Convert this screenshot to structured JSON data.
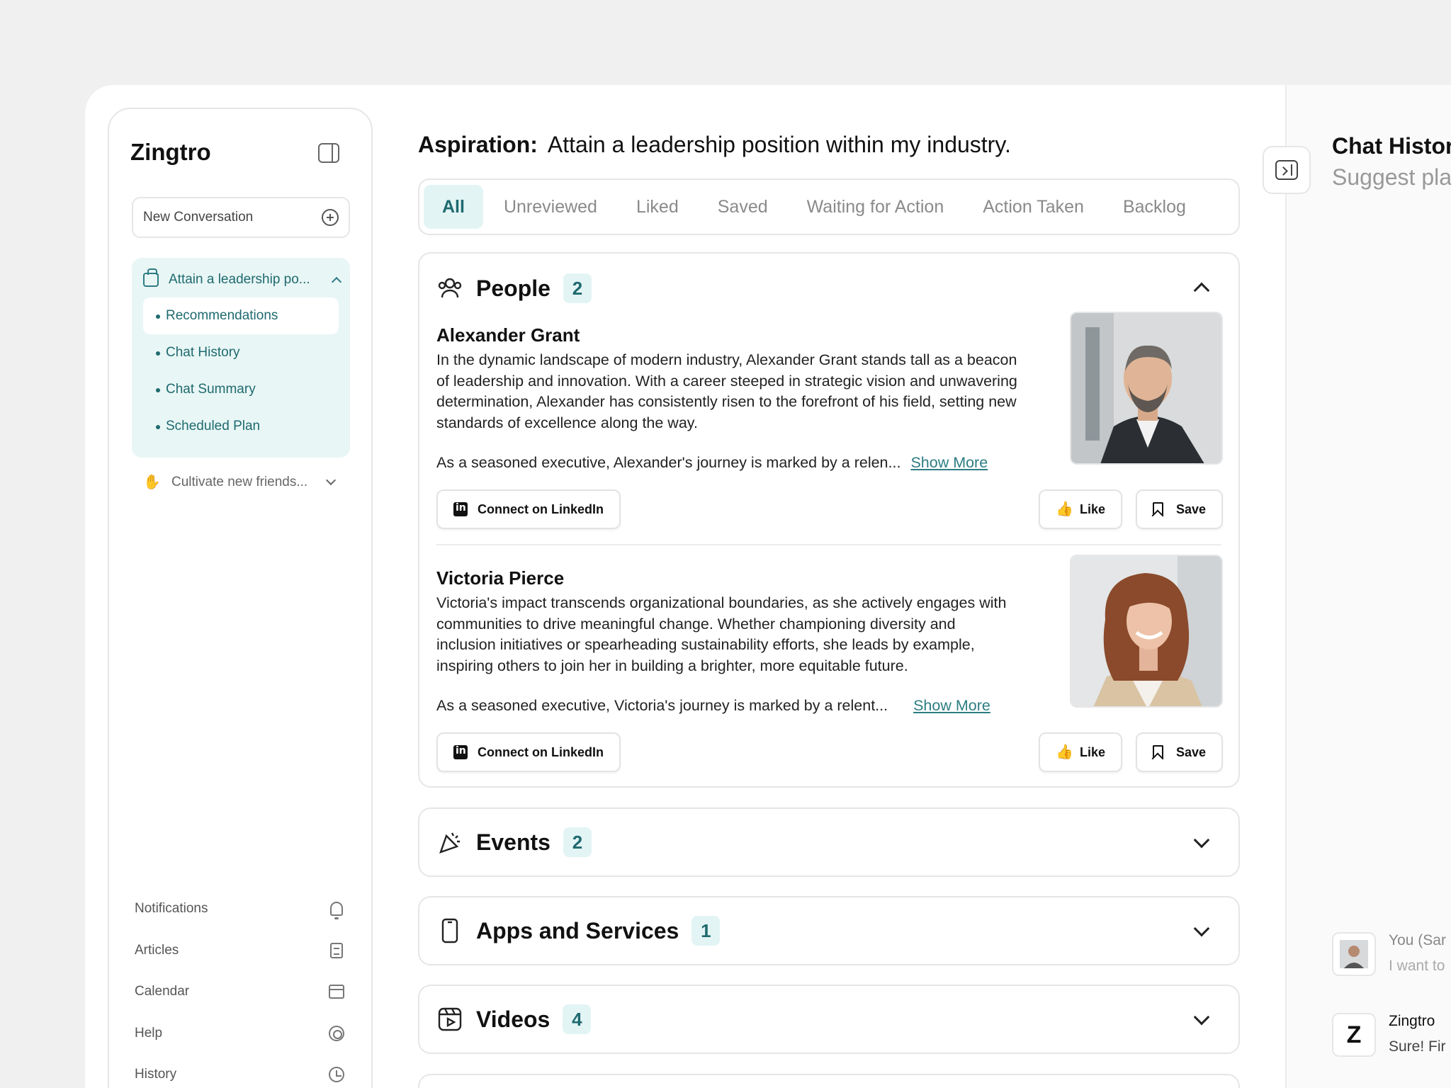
{
  "sidebar": {
    "brand": "Zingtro",
    "new_conversation": "New Conversation",
    "aspiration_group": {
      "label": "Attain a leadership po...",
      "items": [
        {
          "label": "Recommendations",
          "active": true
        },
        {
          "label": "Chat History"
        },
        {
          "label": "Chat Summary"
        },
        {
          "label": "Scheduled Plan"
        }
      ]
    },
    "other_group": "Cultivate new friends...",
    "bottom_nav": [
      {
        "label": "Notifications",
        "icon": "bell-icon"
      },
      {
        "label": "Articles",
        "icon": "document-icon"
      },
      {
        "label": "Calendar",
        "icon": "calendar-icon"
      },
      {
        "label": "Help",
        "icon": "lifebuoy-icon"
      },
      {
        "label": "History",
        "icon": "history-icon"
      }
    ]
  },
  "main": {
    "aspiration_label": "Aspiration:",
    "aspiration_text": "Attain a leadership position within my industry.",
    "tabs": [
      "All",
      "Unreviewed",
      "Liked",
      "Saved",
      "Waiting for Action",
      "Action Taken",
      "Backlog"
    ],
    "active_tab": "All",
    "sections": {
      "people": {
        "title": "People",
        "count": "2",
        "persons": [
          {
            "name": "Alexander Grant",
            "bio": "In the dynamic landscape of modern industry, Alexander Grant stands tall as a beacon of leadership and innovation. With a career steeped in strategic vision and unwavering determination, Alexander has consistently risen to the forefront of his field, setting new standards of excellence along the way.",
            "more": "As a seasoned executive, Alexander's journey is marked by a relen...",
            "show_more": "Show More",
            "connect": "Connect on LinkedIn",
            "like": "Like",
            "save": "Save"
          },
          {
            "name": "Victoria Pierce",
            "bio": "Victoria's impact transcends organizational boundaries, as she actively engages with communities to drive meaningful change. Whether championing diversity and inclusion initiatives or spearheading sustainability efforts, she leads by example, inspiring others to join her in building a brighter, more equitable future.",
            "more": "As a seasoned executive, Victoria's journey is marked by a relent...",
            "show_more": "Show More",
            "connect": "Connect on LinkedIn",
            "like": "Like",
            "save": "Save"
          }
        ]
      },
      "events": {
        "title": "Events",
        "count": "2"
      },
      "apps": {
        "title": "Apps and Services",
        "count": "1"
      },
      "videos": {
        "title": "Videos",
        "count": "4"
      }
    }
  },
  "right_panel": {
    "title": "Chat Histor",
    "subtitle": "Suggest pla",
    "messages": [
      {
        "who": "You (Sar",
        "text": "I want to"
      },
      {
        "who": "Zingtro",
        "text": "Sure! Fir",
        "avatar_letter": "Z"
      }
    ]
  },
  "colors": {
    "accent": "#1f6a6f",
    "accent_bg": "#e3f4f4",
    "border": "#e6e6e6"
  }
}
